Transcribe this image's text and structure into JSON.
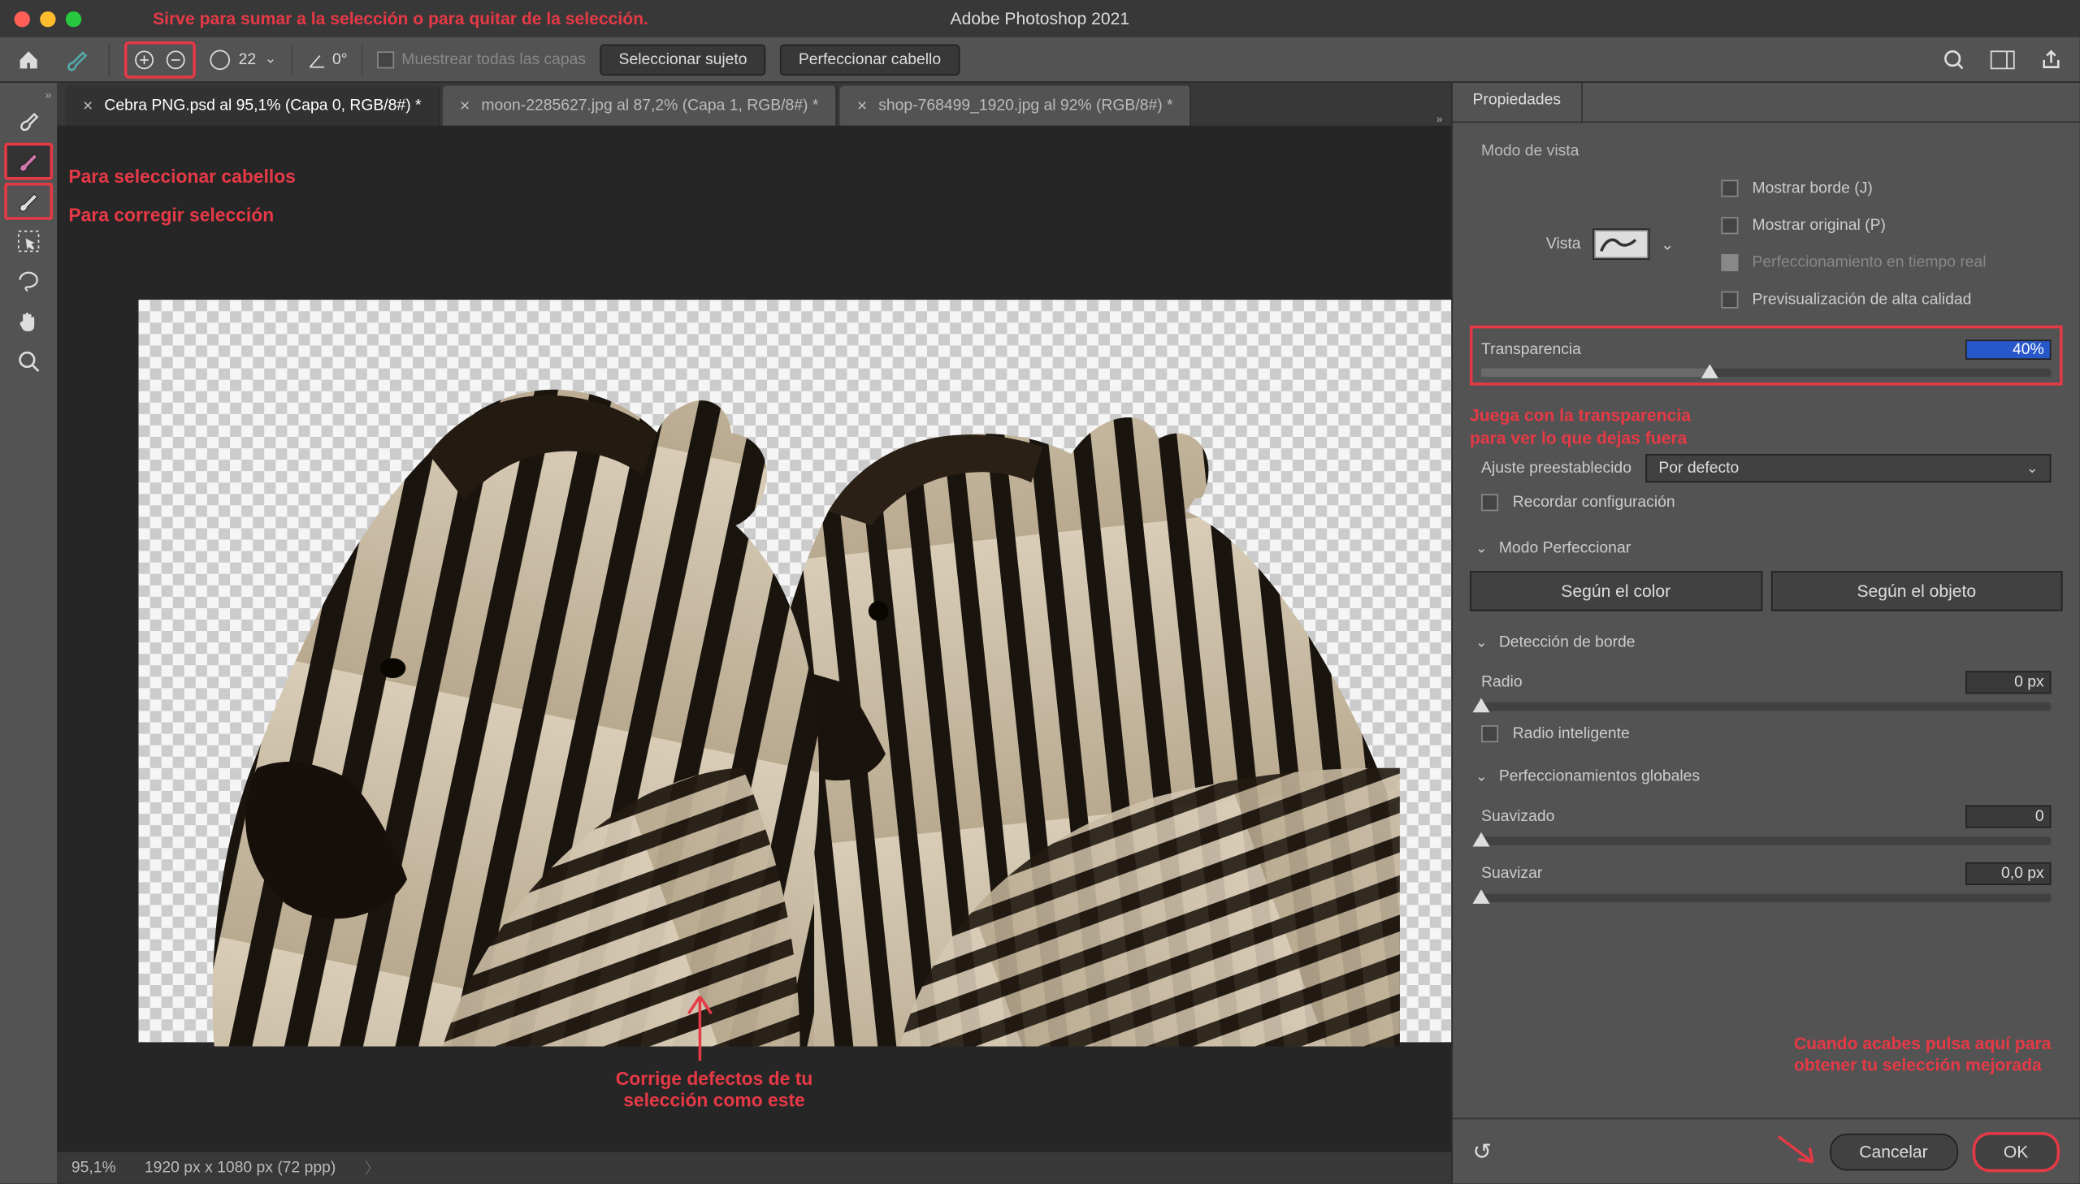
{
  "app_title": "Adobe Photoshop 2021",
  "annotations": {
    "top": "Sirve para sumar a la selección o para quitar de la selección.",
    "tool_hair": "Para seleccionar cabellos",
    "tool_fix": "Para corregir selección",
    "defect_l1": "Corrige defectos de tu",
    "defect_l2": "selección como este",
    "transp_l1": "Juega con la transparencia",
    "transp_l2": "para ver lo que dejas fuera",
    "ok_l1": "Cuando acabes pulsa aquí para",
    "ok_l2": "obtener tu selección mejorada"
  },
  "options_bar": {
    "brush_size": "22",
    "angle_label": "0°",
    "sample_all": "Muestrear todas las capas",
    "select_subject": "Seleccionar sujeto",
    "refine_hair": "Perfeccionar cabello"
  },
  "tabs": [
    {
      "label": "Cebra PNG.psd al 95,1% (Capa 0, RGB/8#) *",
      "active": true
    },
    {
      "label": "moon-2285627.jpg al 87,2% (Capa 1, RGB/8#) *",
      "active": false
    },
    {
      "label": "shop-768499_1920.jpg al 92% (RGB/8#) *",
      "active": false
    }
  ],
  "status": {
    "zoom": "95,1%",
    "dims": "1920 px x 1080 px (72 ppp)"
  },
  "panel": {
    "tab": "Propiedades",
    "view_mode": "Modo de vista",
    "vista": "Vista",
    "show_edge": "Mostrar borde (J)",
    "show_original": "Mostrar original (P)",
    "realtime": "Perfeccionamiento en tiempo real",
    "hq_preview": "Previsualización de alta calidad",
    "transparency": "Transparencia",
    "transparency_val": "40%",
    "preset_label": "Ajuste preestablecido",
    "preset_value": "Por defecto",
    "remember": "Recordar configuración",
    "refine_mode": "Modo Perfeccionar",
    "by_color": "Según el color",
    "by_object": "Según el objeto",
    "edge_detect": "Detección de borde",
    "radius": "Radio",
    "radius_val": "0 px",
    "smart_radius": "Radio inteligente",
    "global": "Perfeccionamientos globales",
    "smooth": "Suavizado",
    "smooth_val": "0",
    "feather": "Suavizar",
    "feather_val": "0,0 px",
    "cancel": "Cancelar",
    "ok": "OK"
  }
}
